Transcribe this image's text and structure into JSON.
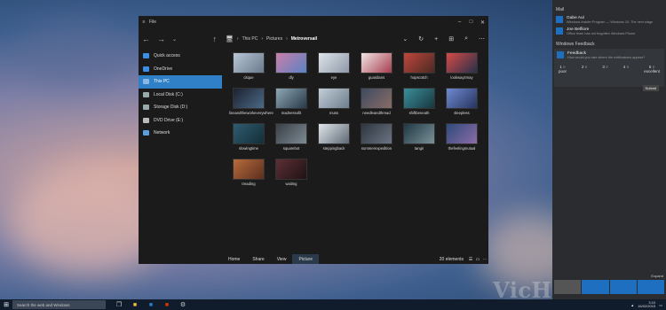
{
  "desktop": {
    "watermark": "VicHounter.org"
  },
  "explorer": {
    "menu_label": "File",
    "nav": {
      "items": [
        {
          "label": "Quick access",
          "icon": "star-icon",
          "active": false
        },
        {
          "label": "OneDrive",
          "icon": "cloud-icon",
          "active": false
        },
        {
          "label": "This PC",
          "icon": "computer-icon",
          "active": true
        },
        {
          "label": "Local Disk (C:)",
          "icon": "drive-icon",
          "active": false
        },
        {
          "label": "Storage Disk (D:)",
          "icon": "drive-icon",
          "active": false
        },
        {
          "label": "DVD Drive (E:)",
          "icon": "dvd-icon",
          "active": false
        },
        {
          "label": "Network",
          "icon": "network-icon",
          "active": false
        }
      ]
    },
    "breadcrumb": [
      "This PC",
      "Pictures",
      "Metroversail"
    ],
    "thumbnails": [
      {
        "label": "citque",
        "colors": [
          "#b8c6d6",
          "#6a7a8c"
        ]
      },
      {
        "label": "dly",
        "colors": [
          "#c97fa8",
          "#5b82c4"
        ]
      },
      {
        "label": "eye",
        "colors": [
          "#dfe4ea",
          "#8d98a8"
        ]
      },
      {
        "label": "guardians",
        "colors": [
          "#f2e5e6",
          "#a63e4f"
        ]
      },
      {
        "label": "hopscotch",
        "colors": [
          "#c0463c",
          "#4b2a24"
        ]
      },
      {
        "label": "lookwayzmay",
        "colors": [
          "#d74a48",
          "#273049"
        ]
      },
      {
        "label": "lineandtheworkeverywhere",
        "colors": [
          "#1c2230",
          "#4b6a86"
        ]
      },
      {
        "label": "madnessofit",
        "colors": [
          "#8fa7b4",
          "#27394a"
        ]
      },
      {
        "label": "muss",
        "colors": [
          "#c2ced7",
          "#6d7d8d"
        ]
      },
      {
        "label": "needleandthread",
        "colors": [
          "#3d4a60",
          "#8a6c66"
        ]
      },
      {
        "label": "shiftbeneath",
        "colors": [
          "#3a8e9a",
          "#18373f"
        ]
      },
      {
        "label": "sleepless",
        "colors": [
          "#6f8ad1",
          "#26345e"
        ]
      },
      {
        "label": "slowingtime",
        "colors": [
          "#2f5d70",
          "#142d38"
        ]
      },
      {
        "label": "squarebot",
        "colors": [
          "#3a3f46",
          "#7d8a93"
        ]
      },
      {
        "label": "steppingback",
        "colors": [
          "#e1e6ea",
          "#5e6975"
        ]
      },
      {
        "label": "summerexpedition",
        "colors": [
          "#2d353f",
          "#6b7482"
        ]
      },
      {
        "label": "tangri",
        "colors": [
          "#203844",
          "#7a9198"
        ]
      },
      {
        "label": "thefeelingmutual",
        "colors": [
          "#2e4a7a",
          "#8d6ca7"
        ]
      },
      {
        "label": "treading",
        "colors": [
          "#b86b3b",
          "#5b2e1e"
        ]
      },
      {
        "label": "waiting",
        "colors": [
          "#5d2f35",
          "#1e1214"
        ]
      }
    ],
    "bottom_tabs": [
      "Home",
      "Share",
      "View",
      "Picture"
    ],
    "active_tab": "Picture",
    "status_count": "20 elements"
  },
  "action_center": {
    "mail_header": "Mail",
    "notifications": [
      {
        "title": "Gabe Aul",
        "detail": "Windows Insider Program — Windows 10. The next stage"
      },
      {
        "title": "Joe Belfiore",
        "detail": "Office team has not forgotten Windows Phone"
      }
    ],
    "feedback_header": "Windows Feedback",
    "feedback": {
      "title": "Feedback",
      "question": "How would you rate where the notifications appear?",
      "ratings": [
        {
          "num": "1",
          "word": "poor"
        },
        {
          "num": "2",
          "word": ""
        },
        {
          "num": "3",
          "word": ""
        },
        {
          "num": "4",
          "word": ""
        },
        {
          "num": "5",
          "word": "excellent"
        }
      ],
      "submit": "Submit"
    },
    "expand": "Expand"
  },
  "taskbar": {
    "search_placeholder": "Search the web and Windows",
    "clock_time": "3:10",
    "clock_date": "16/02/2015"
  },
  "colors": {
    "accent": "#2f80c7",
    "window_bg": "#1b1b1b",
    "taskbar": "#101b2b"
  }
}
